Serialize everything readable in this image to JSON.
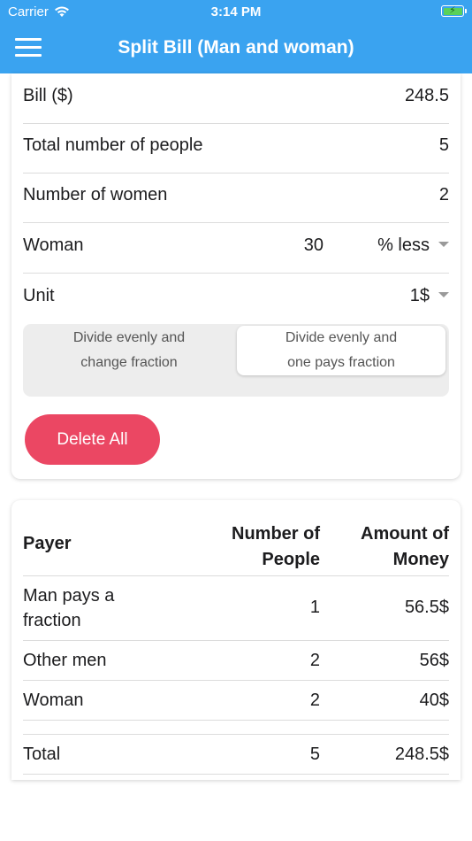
{
  "status_bar": {
    "carrier": "Carrier",
    "time": "3:14 PM",
    "battery_symbol": "⚡"
  },
  "header": {
    "title": "Split Bill (Man and woman)",
    "menu_icon": "hamburger-menu-icon",
    "color": "#3aa3f0"
  },
  "form": {
    "bill_label": "Bill ($)",
    "bill_value": "248.5",
    "people_label": "Total number of people",
    "people_value": "5",
    "women_label": "Number of women",
    "women_value": "2",
    "woman_label": "Woman",
    "woman_percent": "30",
    "woman_mode": "% less",
    "unit_label": "Unit",
    "unit_value": "1$"
  },
  "segment": {
    "left_line1": "Divide evenly and",
    "left_line2": "change fraction",
    "right_line1": "Divide evenly and",
    "right_line2": "one pays fraction",
    "selected": "right"
  },
  "delete_button": {
    "label": "Delete All",
    "color": "#eb4763"
  },
  "table": {
    "headers": {
      "payer": "Payer",
      "people_line1": "Number of",
      "people_line2": "People",
      "amount_line1": "Amount of",
      "amount_line2": "Money"
    },
    "rows": [
      {
        "payer_line1": "Man pays a",
        "payer_line2": "fraction",
        "people": "1",
        "amount": "56.5$"
      },
      {
        "payer": "Other men",
        "people": "2",
        "amount": "56$"
      },
      {
        "payer": "Woman",
        "people": "2",
        "amount": "40$"
      }
    ],
    "total": {
      "payer": "Total",
      "people": "5",
      "amount": "248.5$"
    }
  }
}
